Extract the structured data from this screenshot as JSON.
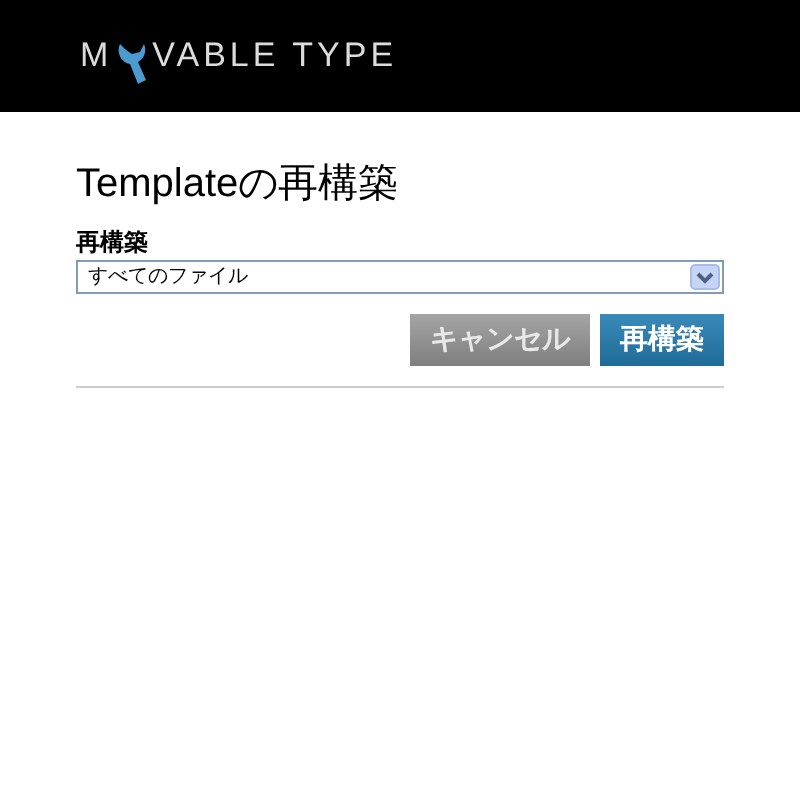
{
  "logo": {
    "text_before": "M",
    "text_after": "VABLE TYPE"
  },
  "title": "Templateの再構築",
  "field": {
    "label": "再構築",
    "value": "すべてのファイル"
  },
  "buttons": [
    {
      "label": "キャンセル",
      "kind": "secondary"
    },
    {
      "label": "再構築",
      "kind": "primary"
    }
  ]
}
